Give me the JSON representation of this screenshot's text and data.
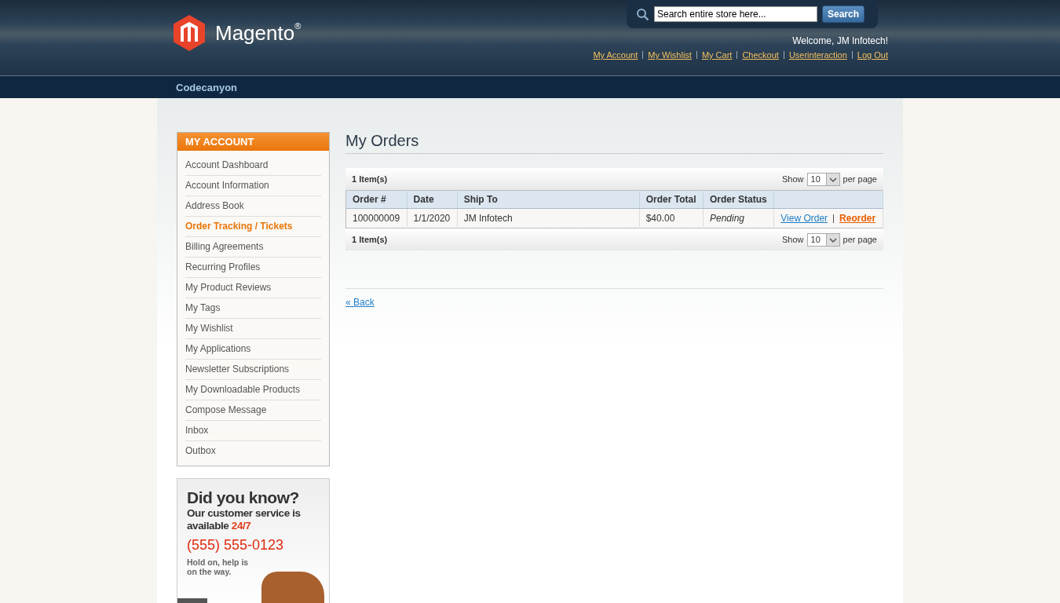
{
  "header": {
    "logo_text": "Magento",
    "logo_mark": "®",
    "search": {
      "placeholder": "Search entire store here..."
    },
    "search_button": "Search",
    "welcome": "Welcome, JM Infotech!",
    "links": [
      "My Account",
      "My Wishlist",
      "My Cart",
      "Checkout",
      "Userinteraction",
      "Log Out"
    ]
  },
  "nav": {
    "items": [
      "Codecanyon"
    ]
  },
  "sidebar": {
    "title": "MY ACCOUNT",
    "items": [
      {
        "label": "Account Dashboard",
        "selected": false
      },
      {
        "label": "Account Information",
        "selected": false
      },
      {
        "label": "Address Book",
        "selected": false
      },
      {
        "label": "Order Tracking / Tickets",
        "selected": true
      },
      {
        "label": "Billing Agreements",
        "selected": false
      },
      {
        "label": "Recurring Profiles",
        "selected": false
      },
      {
        "label": "My Product Reviews",
        "selected": false
      },
      {
        "label": "My Tags",
        "selected": false
      },
      {
        "label": "My Wishlist",
        "selected": false
      },
      {
        "label": "My Applications",
        "selected": false
      },
      {
        "label": "Newsletter Subscriptions",
        "selected": false
      },
      {
        "label": "My Downloadable Products",
        "selected": false
      },
      {
        "label": "Compose Message",
        "selected": false
      },
      {
        "label": "Inbox",
        "selected": false
      },
      {
        "label": "Outbox",
        "selected": false
      }
    ]
  },
  "banner": {
    "heading": "Did you know?",
    "line1": "Our customer service is",
    "line2": "available",
    "line2_highlight": "24/7",
    "phone": "(555) 555-0123",
    "note": "Hold on, help is on the way."
  },
  "page_title": "My Orders",
  "toolbars": [
    {
      "count": "1 Item(s)",
      "show_label": "Show",
      "per_page": "10",
      "per_page_label": "per page"
    },
    {
      "count": "1 Item(s)",
      "show_label": "Show",
      "per_page": "10",
      "per_page_label": "per page"
    }
  ],
  "table": {
    "columns": [
      "Order #",
      "Date",
      "Ship To",
      "Order Total",
      "Order Status"
    ],
    "rows": [
      {
        "cells": [
          "100000009",
          "1/1/2020",
          "JM Infotech",
          "$40.00"
        ],
        "status": "Pending",
        "actions": [
          "View Order",
          "Reorder"
        ]
      }
    ]
  },
  "back_link": "« Back"
}
